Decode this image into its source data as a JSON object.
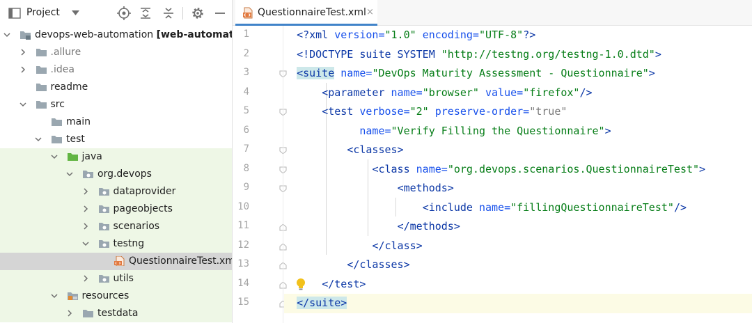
{
  "project_panel": {
    "title": "Project",
    "dropdown_icon": "chevron-down-icon",
    "toolbar": [
      "locate-icon",
      "expand-all-icon",
      "collapse-all-icon",
      "gear-icon",
      "minimize-icon"
    ]
  },
  "tree": [
    {
      "name": "devops-web-automation",
      "suffix": "[web-automatio",
      "depth": 0,
      "arrow": "down",
      "icon": "module-folder",
      "dim": false,
      "bg": "none"
    },
    {
      "name": ".allure",
      "depth": 1,
      "arrow": "right",
      "icon": "folder",
      "dim": true,
      "bg": "none"
    },
    {
      "name": ".idea",
      "depth": 1,
      "arrow": "right",
      "icon": "folder",
      "dim": true,
      "bg": "none"
    },
    {
      "name": "readme",
      "depth": 1,
      "arrow": "none",
      "icon": "folder",
      "dim": false,
      "bg": "none"
    },
    {
      "name": "src",
      "depth": 1,
      "arrow": "down",
      "icon": "folder",
      "dim": false,
      "bg": "none"
    },
    {
      "name": "main",
      "depth": 2,
      "arrow": "none",
      "icon": "folder",
      "dim": false,
      "bg": "none"
    },
    {
      "name": "test",
      "depth": 2,
      "arrow": "down",
      "icon": "folder",
      "dim": false,
      "bg": "none"
    },
    {
      "name": "java",
      "depth": 3,
      "arrow": "down",
      "icon": "source-folder",
      "dim": false,
      "bg": "green"
    },
    {
      "name": "org.devops",
      "depth": 4,
      "arrow": "down",
      "icon": "package",
      "dim": false,
      "bg": "green"
    },
    {
      "name": "dataprovider",
      "depth": 5,
      "arrow": "right",
      "icon": "package",
      "dim": false,
      "bg": "green"
    },
    {
      "name": "pageobjects",
      "depth": 5,
      "arrow": "right",
      "icon": "package",
      "dim": false,
      "bg": "green"
    },
    {
      "name": "scenarios",
      "depth": 5,
      "arrow": "right",
      "icon": "package",
      "dim": false,
      "bg": "green"
    },
    {
      "name": "testng",
      "depth": 5,
      "arrow": "down",
      "icon": "package",
      "dim": false,
      "bg": "green"
    },
    {
      "name": "QuestionnaireTest.xml",
      "depth": 6,
      "arrow": "none",
      "icon": "xml-file",
      "dim": false,
      "bg": "selected"
    },
    {
      "name": "utils",
      "depth": 5,
      "arrow": "right",
      "icon": "package",
      "dim": false,
      "bg": "green"
    },
    {
      "name": "resources",
      "depth": 3,
      "arrow": "down",
      "icon": "resources-folder",
      "dim": false,
      "bg": "green"
    },
    {
      "name": "testdata",
      "depth": 4,
      "arrow": "right",
      "icon": "folder",
      "dim": false,
      "bg": "green"
    }
  ],
  "editor": {
    "tab": {
      "label": "QuestionnaireTest.xml",
      "close": "×"
    },
    "lines": [
      {
        "num": "1",
        "segs": [
          [
            "t",
            "<?"
          ],
          [
            "t",
            "xml "
          ],
          [
            "a",
            "version="
          ],
          [
            "s",
            "\"1.0\""
          ],
          [
            "t",
            " "
          ],
          [
            "a",
            "encoding="
          ],
          [
            "s",
            "\"UTF-8\""
          ],
          [
            "t",
            "?>"
          ]
        ]
      },
      {
        "num": "2",
        "segs": [
          [
            "t",
            "<!DOCTYPE suite SYSTEM "
          ],
          [
            "s",
            "\"http://testng.org/testng-1.0.dtd\""
          ],
          [
            "t",
            ">"
          ]
        ]
      },
      {
        "num": "3",
        "segs": [
          [
            "hl",
            "<"
          ],
          [
            "hl",
            "suite"
          ],
          [
            "t",
            " "
          ],
          [
            "a",
            "name="
          ],
          [
            "s",
            "\"DevOps Maturity Assessment - Questionnaire\""
          ],
          [
            "t",
            ">"
          ]
        ]
      },
      {
        "num": "4",
        "segs": [
          [
            "p",
            "    "
          ],
          [
            "t",
            "<parameter "
          ],
          [
            "a",
            "name="
          ],
          [
            "s",
            "\"browser\""
          ],
          [
            "t",
            " "
          ],
          [
            "a",
            "value="
          ],
          [
            "s",
            "\"firefox\""
          ],
          [
            "t",
            "/>"
          ]
        ]
      },
      {
        "num": "5",
        "segs": [
          [
            "p",
            "    "
          ],
          [
            "t",
            "<test "
          ],
          [
            "a",
            "verbose="
          ],
          [
            "s",
            "\"2\""
          ],
          [
            "t",
            " "
          ],
          [
            "a",
            "preserve-order="
          ],
          [
            "v",
            "\"true\""
          ]
        ]
      },
      {
        "num": "6",
        "segs": [
          [
            "p",
            "          "
          ],
          [
            "a",
            "name="
          ],
          [
            "s",
            "\"Verify Filling the Questionnaire\""
          ],
          [
            "t",
            ">"
          ]
        ]
      },
      {
        "num": "7",
        "segs": [
          [
            "p",
            "        "
          ],
          [
            "t",
            "<classes>"
          ]
        ]
      },
      {
        "num": "8",
        "segs": [
          [
            "p",
            "            "
          ],
          [
            "t",
            "<class "
          ],
          [
            "a",
            "name="
          ],
          [
            "s",
            "\"org.devops.scenarios.QuestionnaireTest\""
          ],
          [
            "t",
            ">"
          ]
        ]
      },
      {
        "num": "9",
        "segs": [
          [
            "p",
            "                "
          ],
          [
            "t",
            "<methods>"
          ]
        ]
      },
      {
        "num": "10",
        "segs": [
          [
            "p",
            "                    "
          ],
          [
            "t",
            "<include "
          ],
          [
            "a",
            "name="
          ],
          [
            "s",
            "\"fillingQuestionnaireTest\""
          ],
          [
            "t",
            "/>"
          ]
        ]
      },
      {
        "num": "11",
        "segs": [
          [
            "p",
            "                "
          ],
          [
            "t",
            "</methods>"
          ]
        ]
      },
      {
        "num": "12",
        "segs": [
          [
            "p",
            "            "
          ],
          [
            "t",
            "</class>"
          ]
        ]
      },
      {
        "num": "13",
        "segs": [
          [
            "p",
            "        "
          ],
          [
            "t",
            "</classes>"
          ]
        ]
      },
      {
        "num": "14",
        "segs": [
          [
            "p",
            "    "
          ],
          [
            "t",
            "</test>"
          ]
        ]
      },
      {
        "num": "15",
        "segs": [
          [
            "hl",
            "</suite>"
          ]
        ]
      }
    ],
    "current_line": 15,
    "intention_icon": "lightbulb-icon"
  },
  "colors": {
    "tag": "#0b37a6",
    "attr": "#1750eb",
    "string": "#067d17",
    "bracket_highlight": "#cde8ea",
    "tab_underline": "#4083c9",
    "test_source_bg": "#eef7e6"
  }
}
